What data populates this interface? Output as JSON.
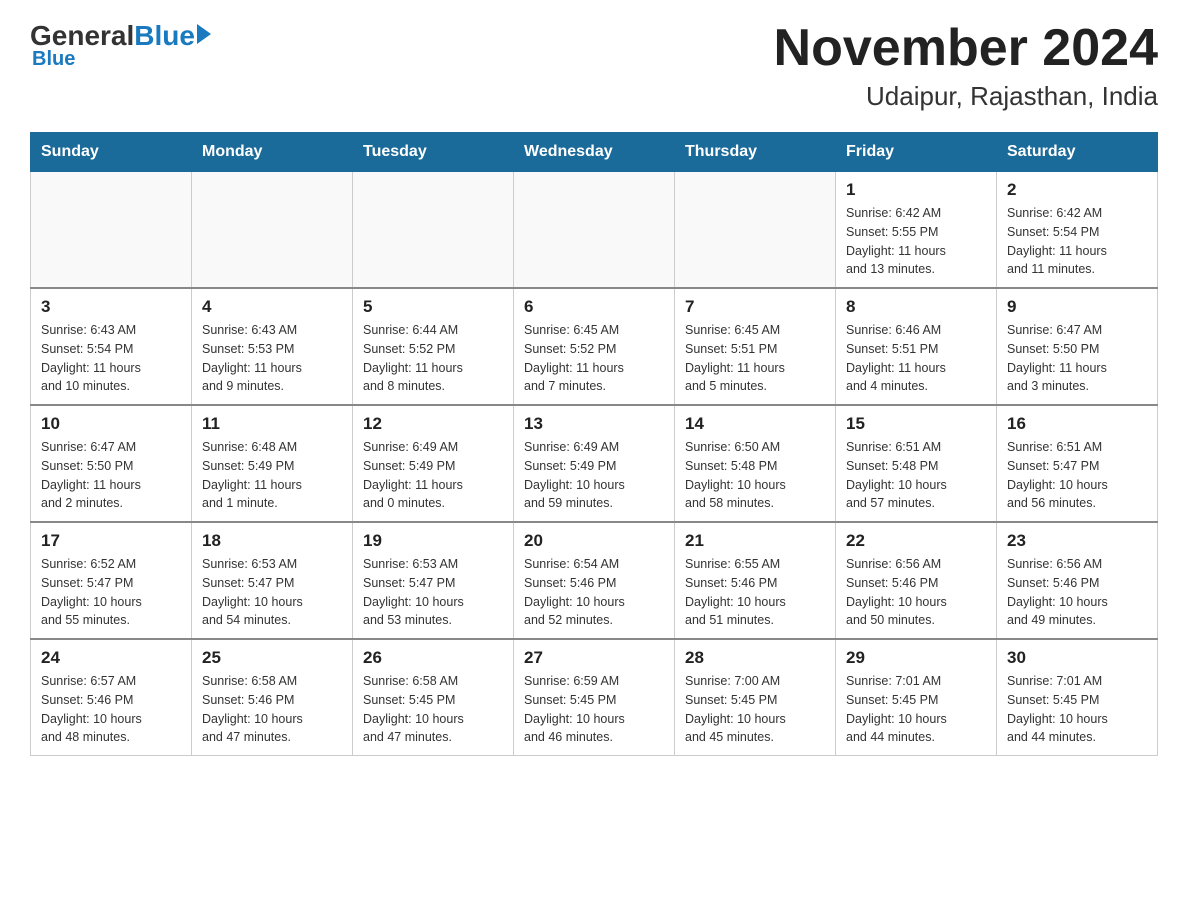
{
  "header": {
    "logo_general": "General",
    "logo_blue": "Blue",
    "calendar_title": "November 2024",
    "calendar_subtitle": "Udaipur, Rajasthan, India"
  },
  "days_of_week": [
    "Sunday",
    "Monday",
    "Tuesday",
    "Wednesday",
    "Thursday",
    "Friday",
    "Saturday"
  ],
  "weeks": [
    [
      {
        "day": "",
        "info": ""
      },
      {
        "day": "",
        "info": ""
      },
      {
        "day": "",
        "info": ""
      },
      {
        "day": "",
        "info": ""
      },
      {
        "day": "",
        "info": ""
      },
      {
        "day": "1",
        "info": "Sunrise: 6:42 AM\nSunset: 5:55 PM\nDaylight: 11 hours\nand 13 minutes."
      },
      {
        "day": "2",
        "info": "Sunrise: 6:42 AM\nSunset: 5:54 PM\nDaylight: 11 hours\nand 11 minutes."
      }
    ],
    [
      {
        "day": "3",
        "info": "Sunrise: 6:43 AM\nSunset: 5:54 PM\nDaylight: 11 hours\nand 10 minutes."
      },
      {
        "day": "4",
        "info": "Sunrise: 6:43 AM\nSunset: 5:53 PM\nDaylight: 11 hours\nand 9 minutes."
      },
      {
        "day": "5",
        "info": "Sunrise: 6:44 AM\nSunset: 5:52 PM\nDaylight: 11 hours\nand 8 minutes."
      },
      {
        "day": "6",
        "info": "Sunrise: 6:45 AM\nSunset: 5:52 PM\nDaylight: 11 hours\nand 7 minutes."
      },
      {
        "day": "7",
        "info": "Sunrise: 6:45 AM\nSunset: 5:51 PM\nDaylight: 11 hours\nand 5 minutes."
      },
      {
        "day": "8",
        "info": "Sunrise: 6:46 AM\nSunset: 5:51 PM\nDaylight: 11 hours\nand 4 minutes."
      },
      {
        "day": "9",
        "info": "Sunrise: 6:47 AM\nSunset: 5:50 PM\nDaylight: 11 hours\nand 3 minutes."
      }
    ],
    [
      {
        "day": "10",
        "info": "Sunrise: 6:47 AM\nSunset: 5:50 PM\nDaylight: 11 hours\nand 2 minutes."
      },
      {
        "day": "11",
        "info": "Sunrise: 6:48 AM\nSunset: 5:49 PM\nDaylight: 11 hours\nand 1 minute."
      },
      {
        "day": "12",
        "info": "Sunrise: 6:49 AM\nSunset: 5:49 PM\nDaylight: 11 hours\nand 0 minutes."
      },
      {
        "day": "13",
        "info": "Sunrise: 6:49 AM\nSunset: 5:49 PM\nDaylight: 10 hours\nand 59 minutes."
      },
      {
        "day": "14",
        "info": "Sunrise: 6:50 AM\nSunset: 5:48 PM\nDaylight: 10 hours\nand 58 minutes."
      },
      {
        "day": "15",
        "info": "Sunrise: 6:51 AM\nSunset: 5:48 PM\nDaylight: 10 hours\nand 57 minutes."
      },
      {
        "day": "16",
        "info": "Sunrise: 6:51 AM\nSunset: 5:47 PM\nDaylight: 10 hours\nand 56 minutes."
      }
    ],
    [
      {
        "day": "17",
        "info": "Sunrise: 6:52 AM\nSunset: 5:47 PM\nDaylight: 10 hours\nand 55 minutes."
      },
      {
        "day": "18",
        "info": "Sunrise: 6:53 AM\nSunset: 5:47 PM\nDaylight: 10 hours\nand 54 minutes."
      },
      {
        "day": "19",
        "info": "Sunrise: 6:53 AM\nSunset: 5:47 PM\nDaylight: 10 hours\nand 53 minutes."
      },
      {
        "day": "20",
        "info": "Sunrise: 6:54 AM\nSunset: 5:46 PM\nDaylight: 10 hours\nand 52 minutes."
      },
      {
        "day": "21",
        "info": "Sunrise: 6:55 AM\nSunset: 5:46 PM\nDaylight: 10 hours\nand 51 minutes."
      },
      {
        "day": "22",
        "info": "Sunrise: 6:56 AM\nSunset: 5:46 PM\nDaylight: 10 hours\nand 50 minutes."
      },
      {
        "day": "23",
        "info": "Sunrise: 6:56 AM\nSunset: 5:46 PM\nDaylight: 10 hours\nand 49 minutes."
      }
    ],
    [
      {
        "day": "24",
        "info": "Sunrise: 6:57 AM\nSunset: 5:46 PM\nDaylight: 10 hours\nand 48 minutes."
      },
      {
        "day": "25",
        "info": "Sunrise: 6:58 AM\nSunset: 5:46 PM\nDaylight: 10 hours\nand 47 minutes."
      },
      {
        "day": "26",
        "info": "Sunrise: 6:58 AM\nSunset: 5:45 PM\nDaylight: 10 hours\nand 47 minutes."
      },
      {
        "day": "27",
        "info": "Sunrise: 6:59 AM\nSunset: 5:45 PM\nDaylight: 10 hours\nand 46 minutes."
      },
      {
        "day": "28",
        "info": "Sunrise: 7:00 AM\nSunset: 5:45 PM\nDaylight: 10 hours\nand 45 minutes."
      },
      {
        "day": "29",
        "info": "Sunrise: 7:01 AM\nSunset: 5:45 PM\nDaylight: 10 hours\nand 44 minutes."
      },
      {
        "day": "30",
        "info": "Sunrise: 7:01 AM\nSunset: 5:45 PM\nDaylight: 10 hours\nand 44 minutes."
      }
    ]
  ]
}
